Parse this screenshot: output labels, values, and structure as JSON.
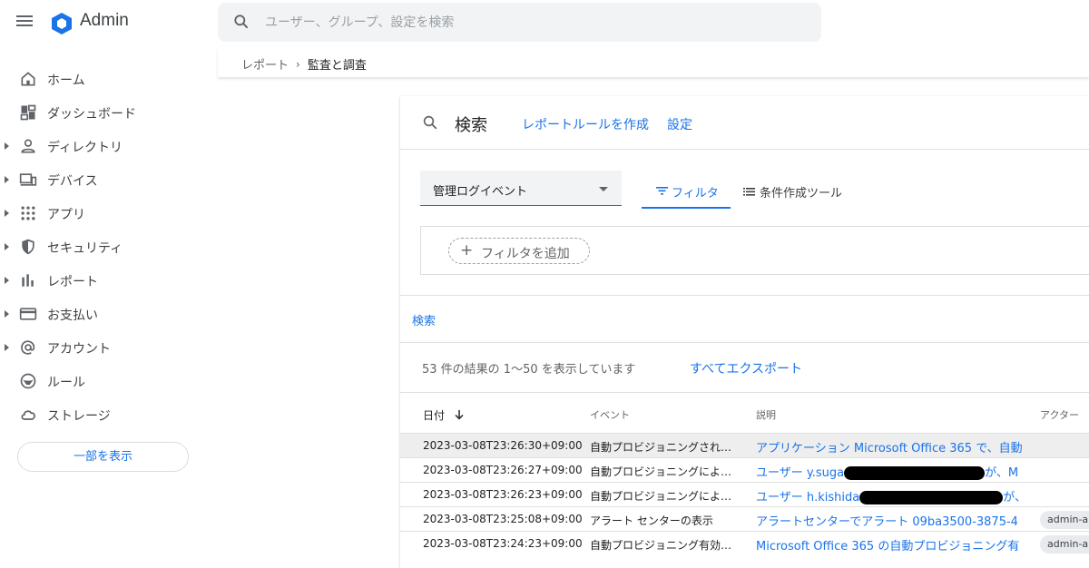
{
  "app": {
    "title": "Admin"
  },
  "search": {
    "placeholder": "ユーザー、グループ、設定を検索"
  },
  "breadcrumb": {
    "parent": "レポート",
    "separator": "›",
    "current": "監査と調査"
  },
  "sidebar": {
    "items": [
      {
        "label": "ホーム",
        "icon": "home-icon",
        "expandable": false
      },
      {
        "label": "ダッシュボード",
        "icon": "dashboard-icon",
        "expandable": false
      },
      {
        "label": "ディレクトリ",
        "icon": "person-icon",
        "expandable": true
      },
      {
        "label": "デバイス",
        "icon": "devices-icon",
        "expandable": true
      },
      {
        "label": "アプリ",
        "icon": "apps-grid-icon",
        "expandable": true
      },
      {
        "label": "セキュリティ",
        "icon": "shield-icon",
        "expandable": true
      },
      {
        "label": "レポート",
        "icon": "bar-chart-icon",
        "expandable": true
      },
      {
        "label": "お支払い",
        "icon": "credit-card-icon",
        "expandable": true
      },
      {
        "label": "アカウント",
        "icon": "at-sign-icon",
        "expandable": true
      },
      {
        "label": "ルール",
        "icon": "rules-icon",
        "expandable": false
      },
      {
        "label": "ストレージ",
        "icon": "cloud-icon",
        "expandable": false
      }
    ],
    "show_less": "一部を表示"
  },
  "card": {
    "title": "検索",
    "link_create_rule": "レポートルールを作成",
    "link_settings": "設定",
    "data_source": "管理ログイベント",
    "tab_filter": "フィルタ",
    "tab_builder": "条件作成ツール",
    "add_filter": "フィルタを追加",
    "search_button": "検索",
    "results_text": "53 件の結果の 1〜50 を表示しています",
    "export_all": "すべてエクスポート"
  },
  "table": {
    "columns": {
      "date": "日付",
      "event": "イベント",
      "description": "説明",
      "actor": "アクター"
    },
    "rows": [
      {
        "date": "2023-03-08T23:26:30+09:00",
        "event": "自動プロビジョニングされ…",
        "description": "アプリケーション Microsoft Office 365 で、自動",
        "actor": "",
        "highlighted": true
      },
      {
        "date": "2023-03-08T23:26:27+09:00",
        "event": "自動プロビジョニングによ…",
        "description_pre": "ユーザー y.suga",
        "description_post": "が、M",
        "actor": ""
      },
      {
        "date": "2023-03-08T23:26:23+09:00",
        "event": "自動プロビジョニングによ…",
        "description_pre": "ユーザー h.kishida",
        "description_post": "が、",
        "actor": ""
      },
      {
        "date": "2023-03-08T23:25:08+09:00",
        "event": "アラート センターの表示",
        "description": "アラートセンターでアラート 09ba3500-3875-4",
        "actor": "admin-al"
      },
      {
        "date": "2023-03-08T23:24:23+09:00",
        "event": "自動プロビジョニング有効…",
        "description": "Microsoft Office 365 の自動プロビジョニング有",
        "actor": "admin-al"
      }
    ]
  }
}
